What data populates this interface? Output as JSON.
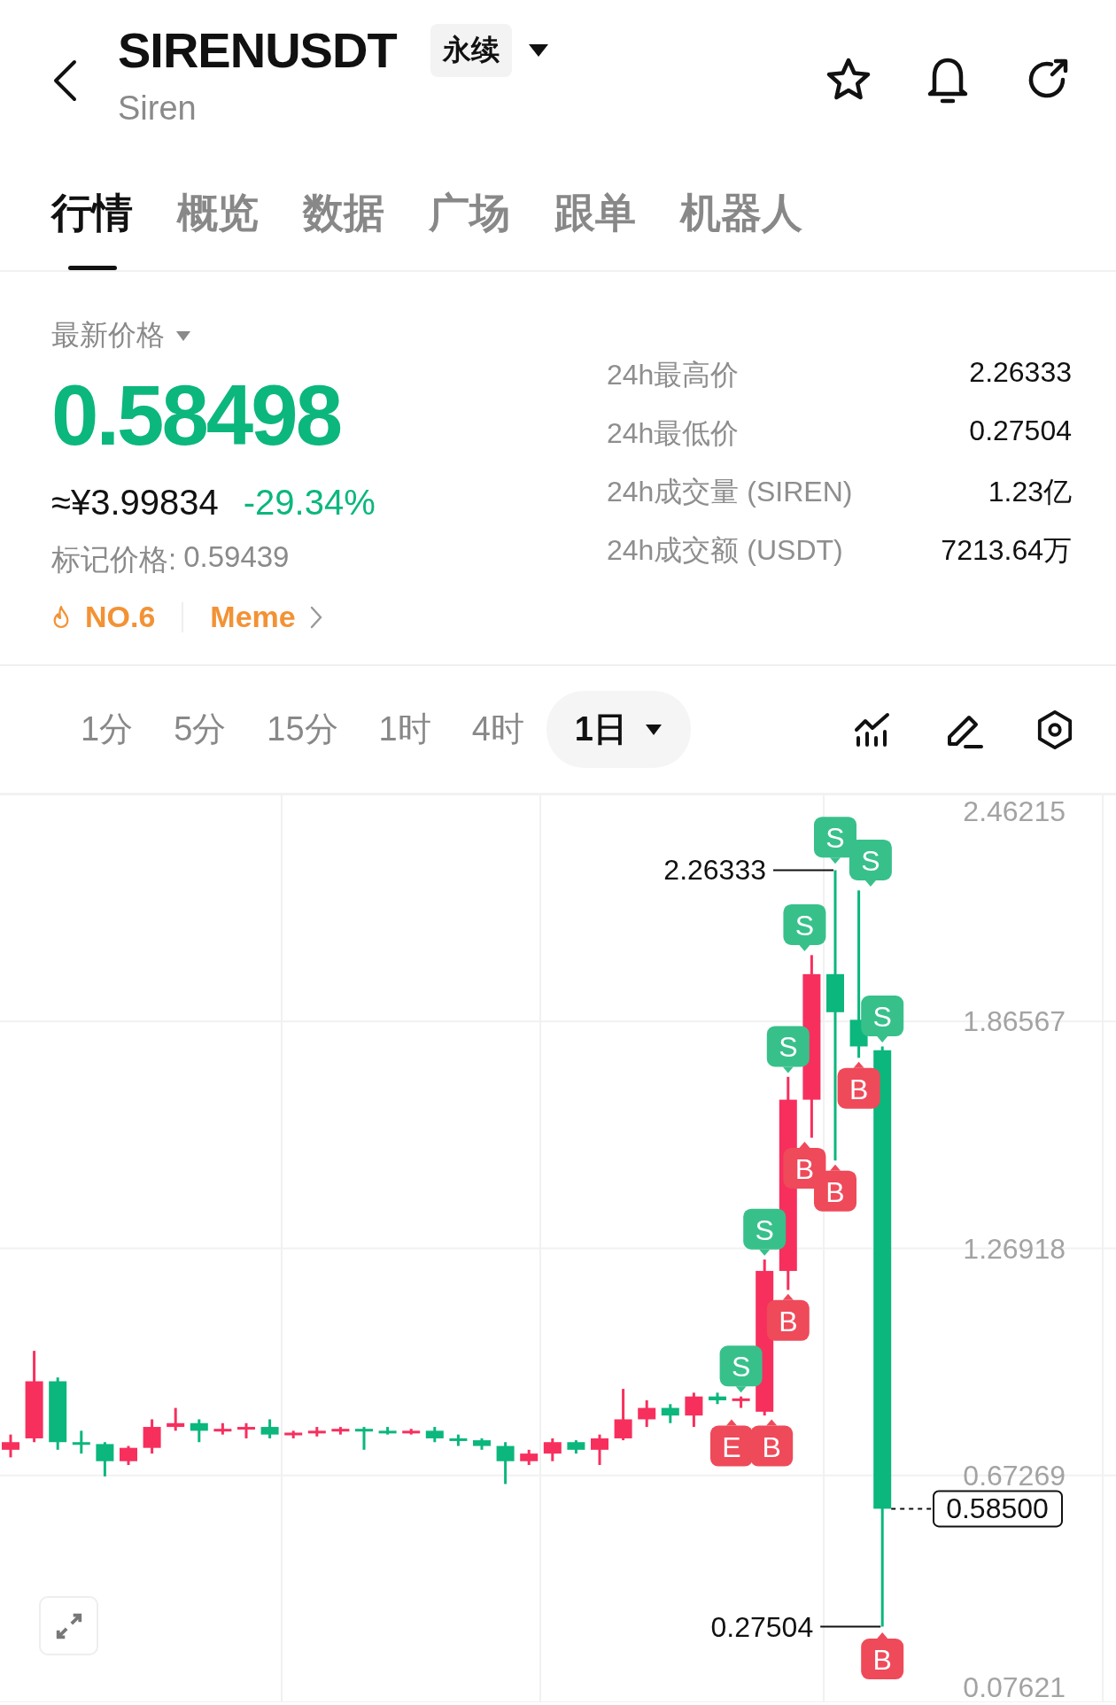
{
  "header": {
    "symbol": "SIRENUSDT",
    "contract_type": "永续",
    "name": "Siren"
  },
  "tabs": [
    {
      "label": "行情",
      "selected": true
    },
    {
      "label": "概览",
      "selected": false
    },
    {
      "label": "数据",
      "selected": false
    },
    {
      "label": "广场",
      "selected": false
    },
    {
      "label": "跟单",
      "selected": false
    },
    {
      "label": "机器人",
      "selected": false
    }
  ],
  "price": {
    "label": "最新价格",
    "last": "0.58498",
    "cny": "≈¥3.99834",
    "change": "-29.34%",
    "mark_label": "标记价格:",
    "mark": "0.59439",
    "rank": "NO.6",
    "category": "Meme"
  },
  "stats": [
    {
      "label": "24h最高价",
      "value": "2.26333"
    },
    {
      "label": "24h最低价",
      "value": "0.27504"
    },
    {
      "label": "24h成交量 (SIREN)",
      "value": "1.23亿"
    },
    {
      "label": "24h成交额 (USDT)",
      "value": "7213.64万"
    }
  ],
  "intervals": [
    {
      "label": "1分",
      "selected": false
    },
    {
      "label": "5分",
      "selected": false
    },
    {
      "label": "15分",
      "selected": false
    },
    {
      "label": "1时",
      "selected": false
    },
    {
      "label": "4时",
      "selected": false
    },
    {
      "label": "1日",
      "selected": true
    }
  ],
  "chart": {
    "chart_data": {
      "type": "candlestick",
      "ylim": [
        0.07621,
        2.46215
      ],
      "yticks": [
        {
          "value": 2.46215,
          "label": "2.46215"
        },
        {
          "value": 1.86567,
          "label": "1.86567"
        },
        {
          "value": 1.26918,
          "label": "1.26918"
        },
        {
          "value": 0.67269,
          "label": "0.67269"
        },
        {
          "value": 0.07621,
          "label": "0.07621"
        }
      ],
      "series": [
        {
          "ohlc": [
            [
              0.74,
              0.78,
              0.72,
              0.76
            ],
            [
              0.77,
              1.0,
              0.76,
              0.92
            ],
            [
              0.92,
              0.93,
              0.74,
              0.76
            ],
            [
              0.76,
              0.79,
              0.73,
              0.755
            ],
            [
              0.755,
              0.76,
              0.67,
              0.71
            ],
            [
              0.71,
              0.75,
              0.7,
              0.745
            ],
            [
              0.745,
              0.82,
              0.73,
              0.8
            ],
            [
              0.8,
              0.85,
              0.79,
              0.81
            ],
            [
              0.81,
              0.82,
              0.76,
              0.79
            ],
            [
              0.79,
              0.81,
              0.78,
              0.795
            ],
            [
              0.795,
              0.81,
              0.77,
              0.8
            ],
            [
              0.8,
              0.82,
              0.77,
              0.78
            ],
            [
              0.78,
              0.79,
              0.77,
              0.785
            ],
            [
              0.785,
              0.8,
              0.775,
              0.79
            ],
            [
              0.79,
              0.8,
              0.78,
              0.795
            ],
            [
              0.795,
              0.8,
              0.74,
              0.79
            ],
            [
              0.79,
              0.8,
              0.78,
              0.785
            ],
            [
              0.785,
              0.795,
              0.78,
              0.79
            ],
            [
              0.79,
              0.8,
              0.76,
              0.77
            ],
            [
              0.77,
              0.78,
              0.75,
              0.765
            ],
            [
              0.765,
              0.77,
              0.74,
              0.75
            ],
            [
              0.75,
              0.76,
              0.65,
              0.71
            ],
            [
              0.71,
              0.74,
              0.7,
              0.73
            ],
            [
              0.73,
              0.77,
              0.71,
              0.76
            ],
            [
              0.76,
              0.765,
              0.73,
              0.74
            ],
            [
              0.74,
              0.78,
              0.7,
              0.77
            ],
            [
              0.77,
              0.9,
              0.765,
              0.82
            ],
            [
              0.82,
              0.87,
              0.8,
              0.85
            ],
            [
              0.85,
              0.86,
              0.81,
              0.83
            ],
            [
              0.83,
              0.89,
              0.8,
              0.88
            ],
            [
              0.88,
              0.89,
              0.86,
              0.87
            ],
            [
              0.87,
              0.88,
              0.85,
              0.875
            ],
            [
              0.84,
              1.24,
              0.83,
              1.21
            ],
            [
              1.21,
              1.72,
              1.16,
              1.66
            ],
            [
              1.66,
              2.04,
              1.56,
              1.99
            ],
            [
              1.99,
              2.26333,
              1.5,
              1.89
            ],
            [
              1.87,
              2.21,
              1.77,
              1.8
            ],
            [
              1.79,
              1.8,
              0.27504,
              0.585
            ]
          ]
        }
      ],
      "grid": true,
      "annotations": [
        "2.26333",
        "0.27504"
      ]
    },
    "last_price_tag": "0.58500",
    "trade_markers": [
      {
        "kind": "sell",
        "text": "S"
      },
      {
        "kind": "buy",
        "text": "E"
      },
      {
        "kind": "buy",
        "text": "B"
      },
      {
        "kind": "sell",
        "text": "S"
      },
      {
        "kind": "buy",
        "text": "B"
      },
      {
        "kind": "sell",
        "text": "S"
      },
      {
        "kind": "buy",
        "text": "B"
      },
      {
        "kind": "sell",
        "text": "S"
      },
      {
        "kind": "buy",
        "text": "B"
      },
      {
        "kind": "sell",
        "text": "S"
      },
      {
        "kind": "buy",
        "text": "B"
      },
      {
        "kind": "sell",
        "text": "S"
      },
      {
        "kind": "sell",
        "text": "S"
      },
      {
        "kind": "buy",
        "text": "B"
      }
    ]
  }
}
